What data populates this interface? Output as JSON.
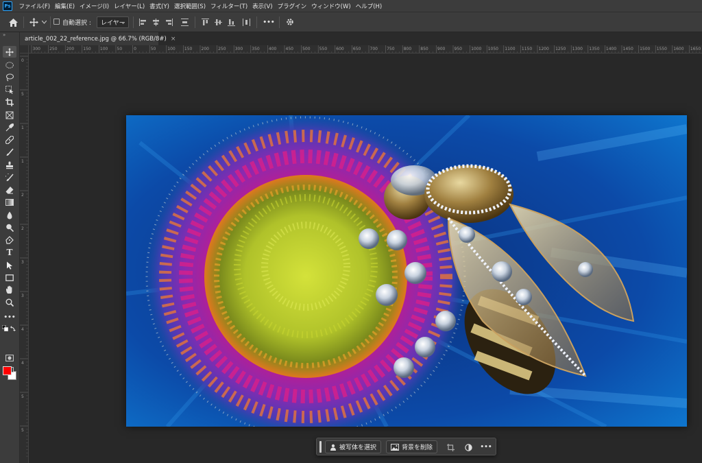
{
  "app": {
    "logo": "Ps"
  },
  "menu": [
    "ファイル(F)",
    "編集(E)",
    "イメージ(I)",
    "レイヤー(L)",
    "書式(Y)",
    "選択範囲(S)",
    "フィルター(T)",
    "表示(V)",
    "プラグイン",
    "ウィンドウ(W)",
    "ヘルプ(H)"
  ],
  "options": {
    "auto_select_label": "自動選択 :",
    "auto_select_checked": false,
    "layer_dropdown_value": "レイヤー",
    "more_label": "•••"
  },
  "document": {
    "tab_title": "article_002_22_reference.jpg @ 66.7% (RGB/8#)",
    "close_glyph": "×"
  },
  "ruler": {
    "top_labels": [
      "300",
      "250",
      "200",
      "150",
      "100",
      "50",
      "0",
      "50",
      "100",
      "150",
      "200",
      "250",
      "300",
      "350",
      "400",
      "450",
      "500",
      "550",
      "600",
      "650",
      "700",
      "750",
      "800",
      "850",
      "900",
      "950",
      "1000",
      "1050",
      "1100",
      "1150",
      "1200",
      "1250",
      "1300",
      "1350",
      "1400",
      "1450",
      "1500",
      "1550",
      "1600",
      "1650",
      "1700",
      "1750"
    ],
    "left_labels": [
      "0",
      "5",
      "1",
      "1",
      "2",
      "2",
      "3",
      "3",
      "4",
      "4",
      "5",
      "5"
    ]
  },
  "tools": [
    "move-icon",
    "marquee-icon",
    "lasso-icon",
    "object-select-icon",
    "crop-icon",
    "frame-icon",
    "eyedropper-icon",
    "healing-brush-icon",
    "brush-icon",
    "stamp-icon",
    "history-brush-icon",
    "eraser-icon",
    "gradient-icon",
    "blur-icon",
    "dodge-icon",
    "pen-icon",
    "type-icon",
    "path-select-icon",
    "rectangle-icon",
    "hand-icon",
    "zoom-icon",
    "more-tools-icon"
  ],
  "colors": {
    "foreground": "#ff0000",
    "background": "#ffffff",
    "accent": "#31a8ff"
  },
  "taskbar": {
    "select_subject_label": "被写体を選択",
    "remove_background_label": "背景を削除",
    "more_label": "•••"
  }
}
